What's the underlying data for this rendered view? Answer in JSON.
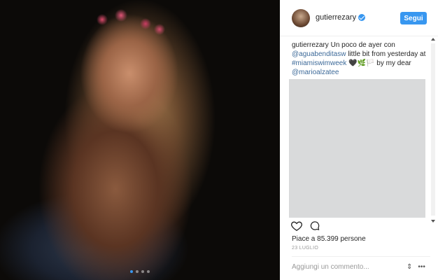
{
  "post": {
    "username": "gutierrezary",
    "follow_label": "Segui",
    "caption_user": "gutierrezary",
    "caption_parts": {
      "intro": " Un poco de ayer con ",
      "mention1": "@aguabenditasw",
      "middle": " little bit from yesterday at ",
      "hashtag": "#miamiswimweek",
      "emoji": " 🖤🌿🏳️ ",
      "by": "by my dear ",
      "mention2": "@marioalzatee"
    },
    "likes": "Piace a 85.399 persone",
    "date": "23 LUGLIO",
    "comment_placeholder": "Aggiungi un commento...",
    "carousel": {
      "count": 4,
      "active": 0
    }
  },
  "icons": {
    "like": "heart-icon",
    "comment": "comment-icon",
    "more": "more-options-icon",
    "verified": "verified-badge-icon"
  },
  "colors": {
    "accent": "#3897f0",
    "link": "#3d6a99",
    "muted": "#999999"
  }
}
